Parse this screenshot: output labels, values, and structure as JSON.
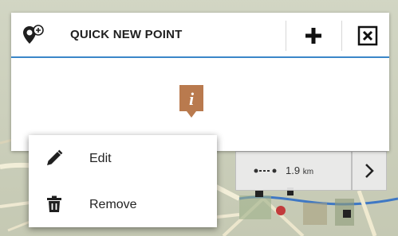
{
  "header": {
    "title": "QUICK NEW POINT",
    "icons": {
      "pin": "map-pin-add-icon",
      "add": "plus-icon",
      "close": "close-box-icon"
    }
  },
  "marker": {
    "icon": "info-icon",
    "letter": "i",
    "color": "#b97a4e"
  },
  "route_info": {
    "distance_value": "1.9",
    "distance_unit": "km",
    "icon": "route-dots-icon"
  },
  "context_menu": {
    "items": [
      {
        "label": "Edit",
        "icon": "pencil-icon"
      },
      {
        "label": "Remove",
        "icon": "trash-icon"
      }
    ]
  },
  "colors": {
    "accent": "#3a86c8",
    "marker": "#b97a4e"
  }
}
